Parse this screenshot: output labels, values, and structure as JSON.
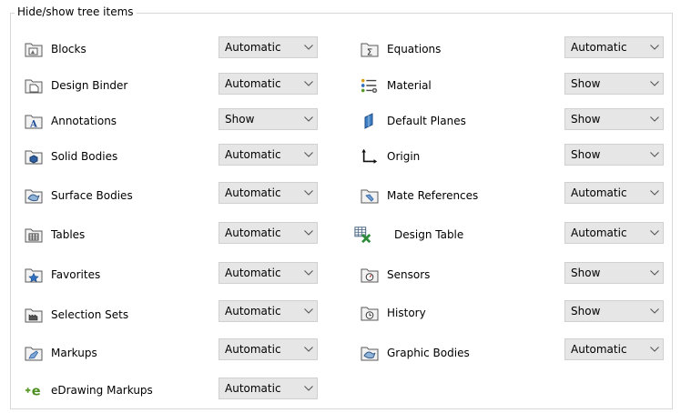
{
  "group_title": "Hide/show tree items",
  "left_column": [
    {
      "label": "Blocks",
      "value": "Automatic",
      "icon": "blocks-folder-icon"
    },
    {
      "label": "Design Binder",
      "value": "Automatic",
      "icon": "design-binder-folder-icon"
    },
    {
      "label": "Annotations",
      "value": "Show",
      "icon": "annotations-folder-icon"
    },
    {
      "label": "Solid Bodies",
      "value": "Automatic",
      "icon": "solid-bodies-folder-icon"
    },
    {
      "label": "Surface Bodies",
      "value": "Automatic",
      "icon": "surface-bodies-folder-icon"
    },
    {
      "label": "Tables",
      "value": "Automatic",
      "icon": "tables-folder-icon"
    },
    {
      "label": "Favorites",
      "value": "Automatic",
      "icon": "favorites-folder-icon"
    },
    {
      "label": "Selection Sets",
      "value": "Automatic",
      "icon": "selection-sets-folder-icon"
    },
    {
      "label": "Markups",
      "value": "Automatic",
      "icon": "markups-folder-icon"
    },
    {
      "label": "eDrawing Markups",
      "value": "Automatic",
      "icon": "edrawing-markups-icon"
    }
  ],
  "right_column": [
    {
      "label": "Equations",
      "value": "Automatic",
      "icon": "equations-folder-icon"
    },
    {
      "label": "Material",
      "value": "Show",
      "icon": "material-icon"
    },
    {
      "label": "Default Planes",
      "value": "Show",
      "icon": "default-planes-icon"
    },
    {
      "label": "Origin",
      "value": "Show",
      "icon": "origin-icon"
    },
    {
      "label": "Mate References",
      "value": "Automatic",
      "icon": "mate-references-folder-icon"
    },
    {
      "label": "Design Table",
      "value": "Automatic",
      "icon": "design-table-icon"
    },
    {
      "label": "Sensors",
      "value": "Show",
      "icon": "sensors-folder-icon"
    },
    {
      "label": "History",
      "value": "Show",
      "icon": "history-folder-icon"
    },
    {
      "label": "Graphic Bodies",
      "value": "Automatic",
      "icon": "graphic-bodies-folder-icon"
    }
  ]
}
